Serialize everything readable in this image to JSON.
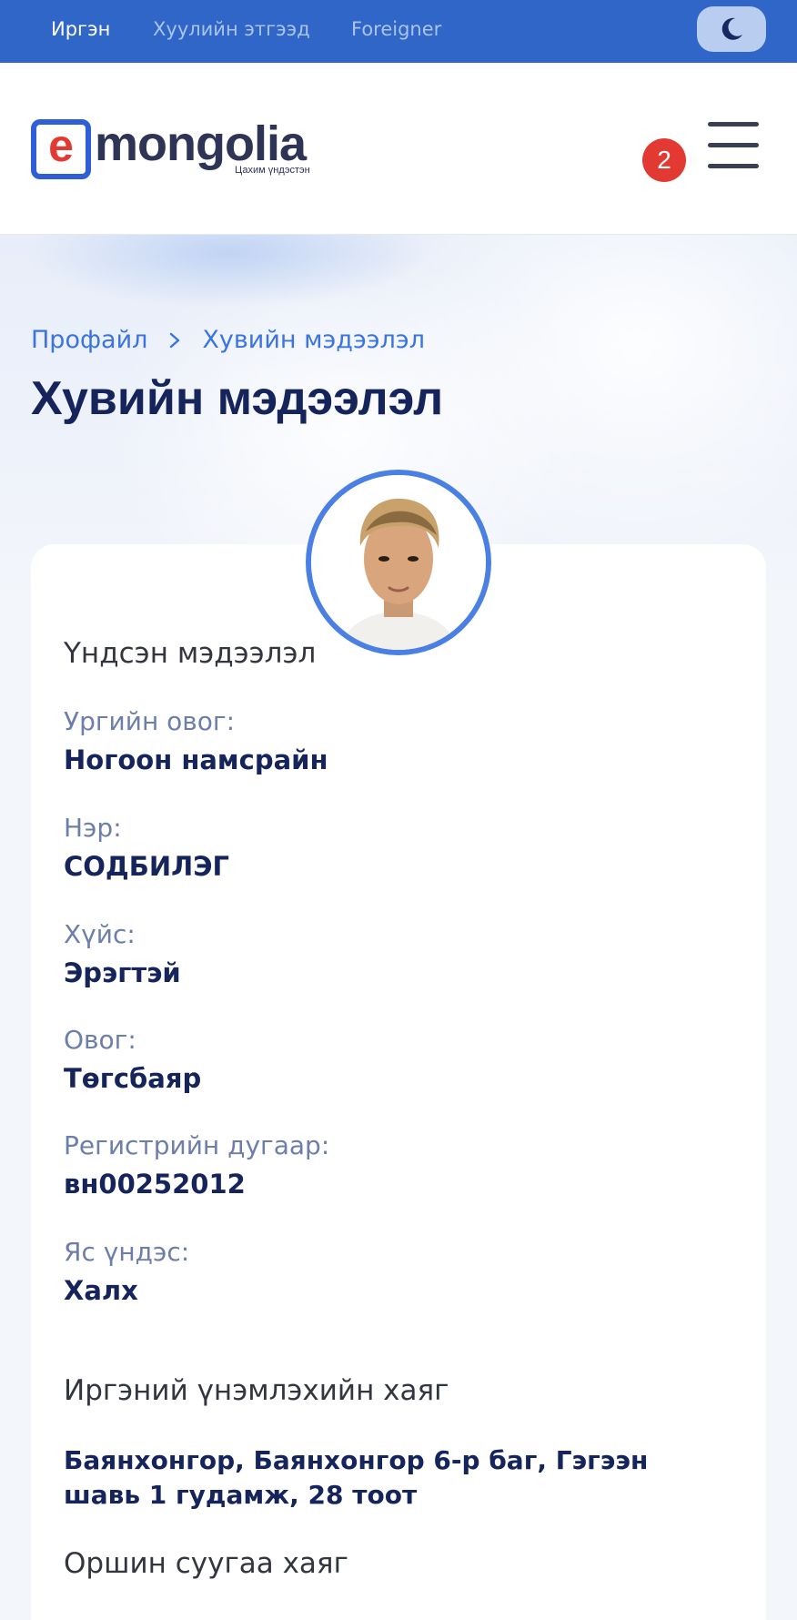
{
  "topbar": {
    "tabs": [
      {
        "label": "Иргэн",
        "active": true
      },
      {
        "label": "Хуулийн этгээд",
        "active": false
      },
      {
        "label": "Foreigner",
        "active": false
      }
    ],
    "theme_icon": "moon-icon"
  },
  "header": {
    "logo_letter": "e",
    "logo_word": "mongolia",
    "logo_tagline": "Цахим үндэстэн",
    "notification_count": "2",
    "menu_icon": "hamburger-icon"
  },
  "breadcrumb": {
    "items": [
      "Профайл",
      "Хувийн мэдээлэл"
    ]
  },
  "page": {
    "title": "Хувийн мэдээлэл"
  },
  "profile": {
    "basic_section_title": "Үндсэн мэдээлэл",
    "fields": [
      {
        "label": "Ургийн овог:",
        "value": "Ногоон намсрайн"
      },
      {
        "label": "Нэр:",
        "value": "СОДБИЛЭГ"
      },
      {
        "label": "Хүйс:",
        "value": "Эрэгтэй"
      },
      {
        "label": "Овог:",
        "value": "Төгсбаяр"
      },
      {
        "label": "Регистрийн дугаар:",
        "value": "вн00252012"
      },
      {
        "label": "Яс үндэс:",
        "value": "Халх"
      }
    ],
    "id_address_title": "Иргэний үнэмлэхийн хаяг",
    "id_address": "Баянхонгор, Баянхонгор 6-р баг, Гэгээн шавь 1 гудамж, 28 тоот",
    "residence_title": "Оршин суугаа хаяг"
  },
  "colors": {
    "topbar": "#2f66c7",
    "accent": "#3b74e0",
    "title": "#15245a",
    "badge": "#e23a32"
  }
}
